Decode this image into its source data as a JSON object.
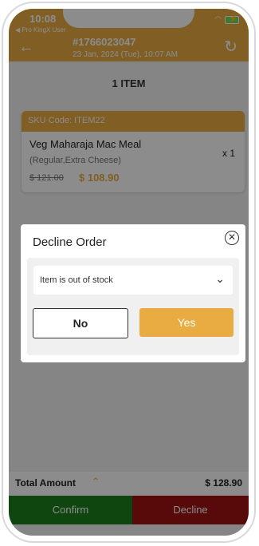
{
  "status_bar": {
    "time": "10:08",
    "back_app": "◀ Pro KingX User"
  },
  "header": {
    "order_id": "#1766023047",
    "order_date": "23 Jan, 2024 (Tue),  10:07 AM"
  },
  "item_count": "1 ITEM",
  "item": {
    "sku": "SKU Code: ITEM22",
    "name": "Veg Maharaja Mac Meal",
    "options": "(Regular,Extra Cheese)",
    "qty": "x 1",
    "price_old": "$ 121.00",
    "price_new": "$ 108.90"
  },
  "dialog": {
    "title": "Decline Order",
    "reason": "Item is out of stock",
    "no_label": "No",
    "yes_label": "Yes"
  },
  "footer": {
    "total_label": "Total Amount",
    "total_value": "$ 128.90",
    "confirm_label": "Confirm",
    "decline_label": "Decline"
  },
  "colors": {
    "accent": "#e9ac42",
    "confirm": "#1d7f1d",
    "decline": "#a01111"
  }
}
